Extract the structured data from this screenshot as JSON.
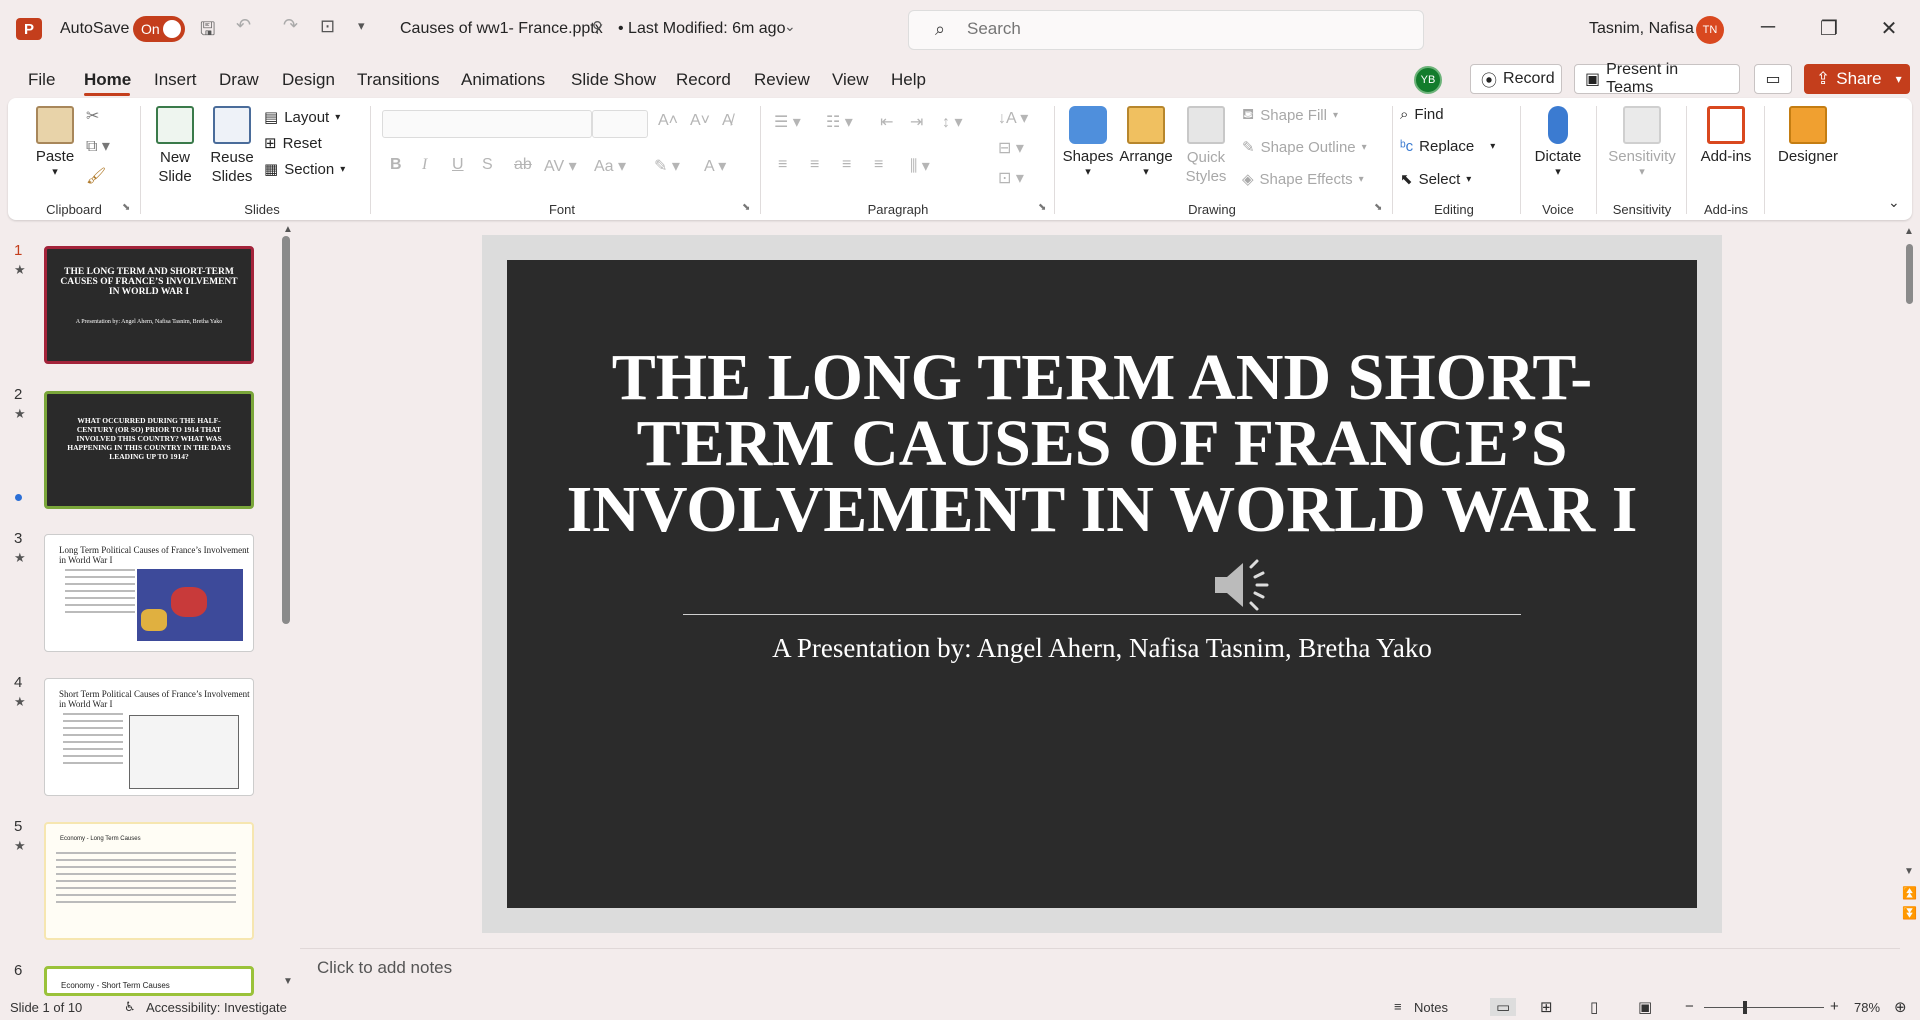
{
  "titlebar": {
    "app_icon": "P",
    "autosave_label": "AutoSave",
    "autosave_state": "On",
    "doc_title": "Causes of ww1- France.pptx",
    "modified": "• Last Modified: 6m ago",
    "search_placeholder": "Search",
    "user_name": "Tasnim, Nafisa",
    "user_initials": "TN"
  },
  "menu": {
    "tabs": [
      "File",
      "Home",
      "Insert",
      "Draw",
      "Design",
      "Transitions",
      "Animations",
      "Slide Show",
      "Record",
      "Review",
      "View",
      "Help"
    ],
    "collab_initials": "YB",
    "record_label": "Record",
    "present_label": "Present in Teams",
    "share_label": "Share"
  },
  "ribbon": {
    "clipboard": {
      "paste": "Paste",
      "label": "Clipboard"
    },
    "slides": {
      "new_slide": "New Slide",
      "reuse_slides": "Reuse Slides",
      "layout": "Layout",
      "reset": "Reset",
      "section": "Section",
      "label": "Slides"
    },
    "font": {
      "label": "Font"
    },
    "paragraph": {
      "label": "Paragraph"
    },
    "drawing": {
      "shapes": "Shapes",
      "arrange": "Arrange",
      "quick_styles": "Quick Styles",
      "shape_fill": "Shape Fill",
      "shape_outline": "Shape Outline",
      "shape_effects": "Shape Effects",
      "label": "Drawing"
    },
    "editing": {
      "find": "Find",
      "replace": "Replace",
      "select": "Select",
      "label": "Editing"
    },
    "voice": {
      "dictate": "Dictate",
      "label": "Voice"
    },
    "sensitivity": {
      "sensitivity": "Sensitivity",
      "label": "Sensitivity"
    },
    "addins": {
      "addins": "Add-ins",
      "label": "Add-ins"
    },
    "designer": {
      "designer": "Designer"
    }
  },
  "thumbnails": [
    {
      "num": "1",
      "title": "THE LONG TERM AND SHORT-TERM CAUSES OF FRANCE’S INVOLVEMENT IN WORLD WAR I",
      "sub": "A Presentation by: Angel Ahern, Nafisa Tasnim, Bretha Yako"
    },
    {
      "num": "2",
      "title": "WHAT OCCURRED DURING THE HALF-CENTURY (OR SO) PRIOR TO 1914 THAT INVOLVED THIS COUNTRY? WHAT WAS HAPPENING IN THIS COUNTRY IN THE DAYS LEADING UP TO 1914?"
    },
    {
      "num": "3",
      "title": "Long Term Political Causes of France’s Involvement in World War I"
    },
    {
      "num": "4",
      "title": "Short Term Political Causes of France’s Involvement in World War I"
    },
    {
      "num": "5",
      "title": "Economy - Long Term Causes"
    },
    {
      "num": "6",
      "title": "Economy - Short Term Causes"
    }
  ],
  "slide": {
    "title": "THE LONG TERM AND SHORT-TERM CAUSES OF FRANCE’S INVOLVEMENT IN WORLD WAR I",
    "subtitle": "A Presentation by: Angel Ahern, Nafisa Tasnim, Bretha Yako"
  },
  "notes_placeholder": "Click to add notes",
  "status": {
    "slide_counter": "Slide 1 of 10",
    "accessibility": "Accessibility: Investigate",
    "notes": "Notes",
    "zoom": "78%"
  }
}
